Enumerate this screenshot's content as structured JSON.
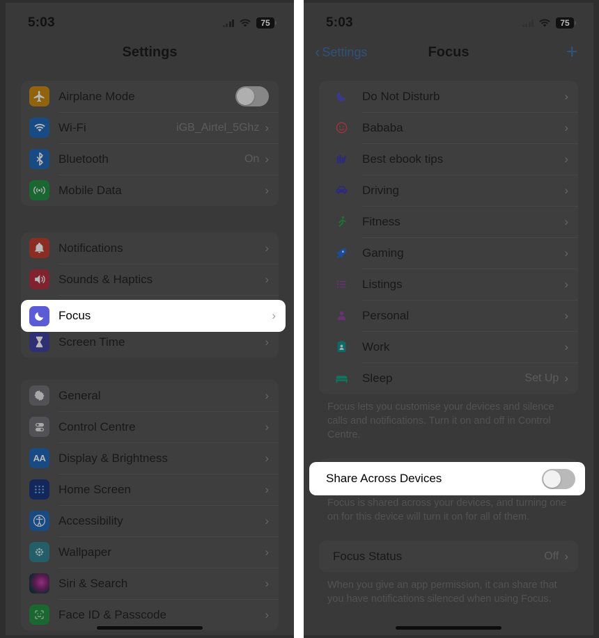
{
  "status_bar": {
    "time": "5:03",
    "battery_percent": "75",
    "wifi_icon": "wifi-icon",
    "signal_icon": "cellular-signal-icon"
  },
  "left_phone": {
    "nav": {
      "title": "Settings"
    },
    "groups": [
      {
        "rows": [
          {
            "label": "Airplane Mode",
            "icon": "airplane-icon",
            "control": "toggle",
            "toggle_on": false
          },
          {
            "label": "Wi-Fi",
            "icon": "wifi-tile-icon",
            "value": "iGB_Airtel_5Ghz",
            "control": "chevron"
          },
          {
            "label": "Bluetooth",
            "icon": "bluetooth-icon",
            "value": "On",
            "control": "chevron"
          },
          {
            "label": "Mobile Data",
            "icon": "mobile-data-icon",
            "value": "",
            "control": "chevron"
          }
        ]
      },
      {
        "rows": [
          {
            "label": "Notifications",
            "icon": "notifications-icon",
            "value": "",
            "control": "chevron"
          },
          {
            "label": "Sounds & Haptics",
            "icon": "sounds-icon",
            "value": "",
            "control": "chevron"
          },
          {
            "label": "Focus",
            "icon": "focus-moon-icon",
            "value": "",
            "control": "chevron"
          },
          {
            "label": "Screen Time",
            "icon": "screen-time-icon",
            "value": "",
            "control": "chevron"
          }
        ]
      },
      {
        "rows": [
          {
            "label": "General",
            "icon": "gear-icon",
            "value": "",
            "control": "chevron"
          },
          {
            "label": "Control Centre",
            "icon": "control-centre-icon",
            "value": "",
            "control": "chevron"
          },
          {
            "label": "Display & Brightness",
            "icon": "display-brightness-icon",
            "value": "",
            "control": "chevron"
          },
          {
            "label": "Home Screen",
            "icon": "home-screen-icon",
            "value": "",
            "control": "chevron"
          },
          {
            "label": "Accessibility",
            "icon": "accessibility-icon",
            "value": "",
            "control": "chevron"
          },
          {
            "label": "Wallpaper",
            "icon": "wallpaper-icon",
            "value": "",
            "control": "chevron"
          },
          {
            "label": "Siri & Search",
            "icon": "siri-icon",
            "value": "",
            "control": "chevron"
          },
          {
            "label": "Face ID & Passcode",
            "icon": "face-id-icon",
            "value": "",
            "control": "chevron"
          }
        ]
      }
    ],
    "highlight": {
      "label": "Focus",
      "icon": "focus-moon-icon",
      "chevron": "›"
    }
  },
  "right_phone": {
    "nav": {
      "back_label": "Settings",
      "back_icon": "chevron-left-icon",
      "title": "Focus",
      "add_icon": "plus-icon",
      "add_label": "+"
    },
    "focus_list": [
      {
        "label": "Do Not Disturb",
        "icon": "moon-icon",
        "value": ""
      },
      {
        "label": "Bababa",
        "icon": "smiley-icon",
        "value": ""
      },
      {
        "label": "Best ebook tips",
        "icon": "books-icon",
        "value": ""
      },
      {
        "label": "Driving",
        "icon": "car-icon",
        "value": ""
      },
      {
        "label": "Fitness",
        "icon": "running-icon",
        "value": ""
      },
      {
        "label": "Gaming",
        "icon": "rocket-icon",
        "value": ""
      },
      {
        "label": "Listings",
        "icon": "list-icon",
        "value": ""
      },
      {
        "label": "Personal",
        "icon": "person-icon",
        "value": ""
      },
      {
        "label": "Work",
        "icon": "badge-icon",
        "value": ""
      },
      {
        "label": "Sleep",
        "icon": "bed-icon",
        "value": "Set Up"
      }
    ],
    "focus_note": "Focus lets you customise your devices and silence calls and notifications. Turn it on and off in Control Centre.",
    "share_row": {
      "label": "Share Across Devices",
      "toggle_on": false
    },
    "share_note": "Focus is shared across your devices, and turning one on for this device will turn it on for all of them.",
    "status_row": {
      "label": "Focus Status",
      "value": "Off",
      "chevron": "›"
    },
    "status_note": "When you give an app permission, it can share that you have notifications silenced when using Focus."
  },
  "colors": {
    "accent_blue": "#3a6ea8",
    "focus_purple": "#5b5bd6",
    "highlight_white": "#ffffff"
  },
  "glyphs": {
    "chevron_right": "›",
    "chevron_left": "‹",
    "plus": "+"
  }
}
